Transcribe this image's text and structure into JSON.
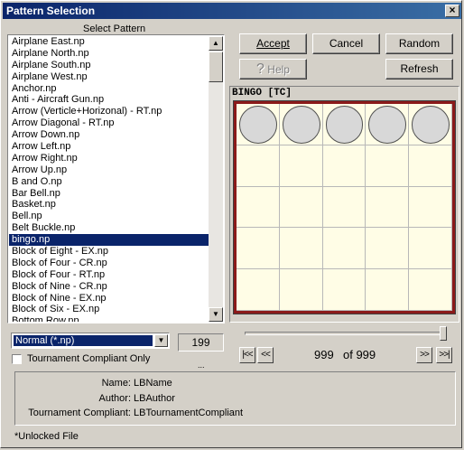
{
  "window": {
    "title": "Pattern Selection",
    "close_glyph": "×"
  },
  "select_pattern_label": "Select Pattern",
  "patterns": [
    "Airplane East.np",
    "Airplane North.np",
    "Airplane South.np",
    "Airplane West.np",
    "Anchor.np",
    "Anti - Aircraft Gun.np",
    "Arrow (Verticle+Horizonal) - RT.np",
    "Arrow Diagonal - RT.np",
    "Arrow Down.np",
    "Arrow Left.np",
    "Arrow Right.np",
    "Arrow Up.np",
    "B and O.np",
    "Bar Bell.np",
    "Basket.np",
    "Bell.np",
    "Belt Buckle.np",
    "bingo.np",
    "Block of Eight - EX.np",
    "Block of Four - CR.np",
    "Block of Four - RT.np",
    "Block of Nine - CR.np",
    "Block of Nine - EX.np",
    "Block of Six - EX.np",
    "Bottom Row.np"
  ],
  "selected_index": 17,
  "file_filter": {
    "value": "Normal (*.np)"
  },
  "pattern_count": "199",
  "tournament_checkbox": {
    "label": "Tournament Compliant Only",
    "checked": false
  },
  "ellipsis": "...",
  "buttons": {
    "accept": "Accept",
    "cancel": "Cancel",
    "random": "Random",
    "help": "Help",
    "refresh": "Refresh"
  },
  "pattern_title": "BINGO [TC]",
  "pattern_grid": {
    "rows": 5,
    "cols": 5,
    "daubed": [
      [
        0,
        0
      ],
      [
        0,
        1
      ],
      [
        0,
        2
      ],
      [
        0,
        3
      ],
      [
        0,
        4
      ]
    ]
  },
  "slider": {
    "value_fraction": 1.0
  },
  "nav": {
    "first": "|<<",
    "prev": "<<",
    "next": ">>",
    "last": ">>|",
    "position": "999",
    "of_text": "of 999"
  },
  "info": {
    "name_label": "Name:",
    "name_value": "LBName",
    "author_label": "Author:",
    "author_value": "LBAuthor",
    "tc_label": "Tournament Compliant:",
    "tc_value": "LBTournamentCompliant"
  },
  "status": "*Unlocked File",
  "colors": {
    "titlebar": "#0a246a",
    "selection": "#0a246a",
    "grid_border": "#8b1a1a",
    "grid_bg": "#fffde6"
  }
}
